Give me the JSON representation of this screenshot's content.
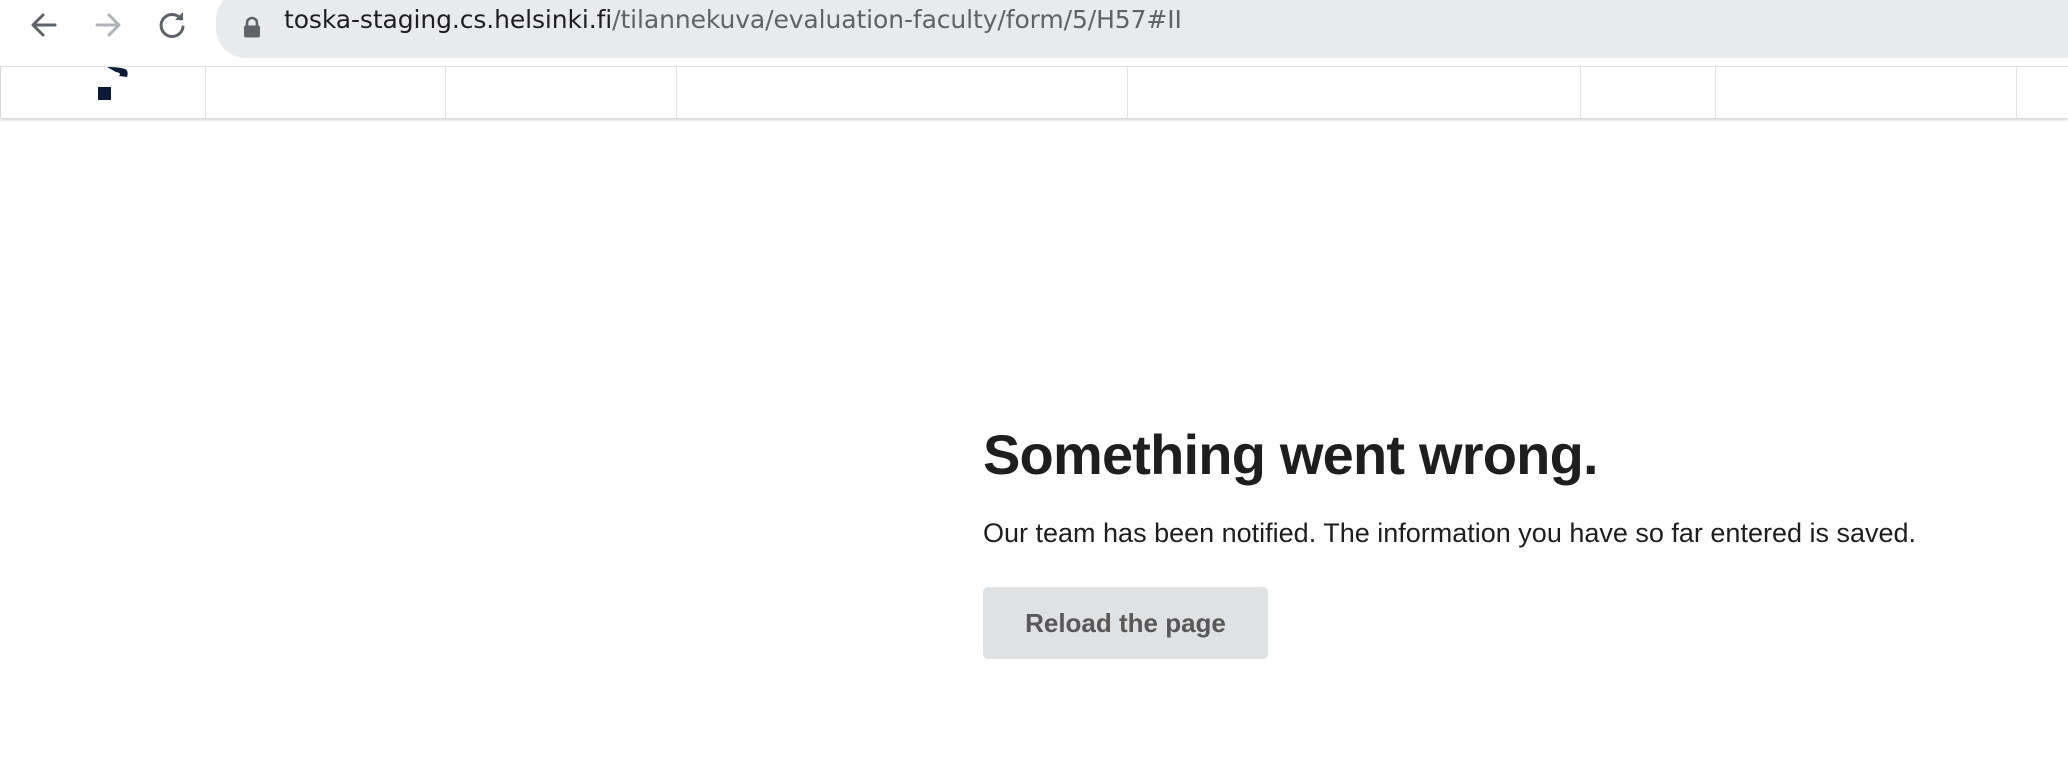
{
  "browser": {
    "url_host": "toska-staging.cs.helsinki.fi",
    "url_path": "/tilannekuva/evaluation-faculty/form/5/H57#II",
    "icons": {
      "back": "arrow-left-icon",
      "forward": "arrow-right-icon",
      "reload": "reload-icon",
      "secure": "lock-icon"
    }
  },
  "header": {
    "logo": "university-logo",
    "menu_item_count": 8
  },
  "error": {
    "title": "Something went wrong.",
    "message": "Our team has been notified. The information you have so far entered is saved.",
    "reload_label": "Reload the page"
  },
  "colors": {
    "button_bg": "#e0e1e2",
    "button_text": "#585858",
    "address_bar_bg": "#e9eaec",
    "text": "#1e1e1e"
  }
}
